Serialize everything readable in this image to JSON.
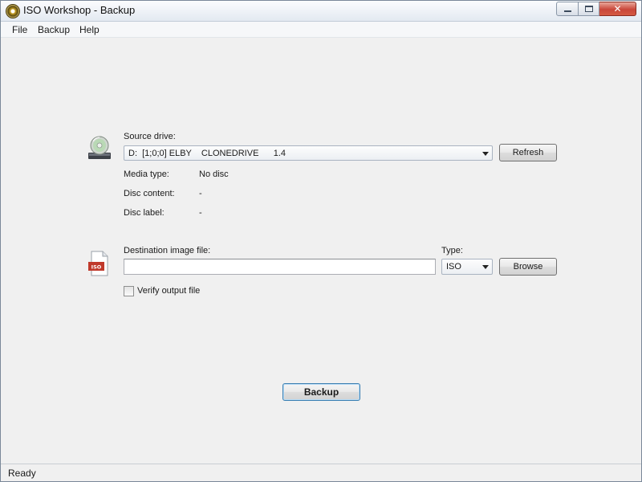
{
  "window": {
    "title": "ISO Workshop - Backup",
    "icon": "app-disc-icon"
  },
  "menu": {
    "items": [
      "File",
      "Backup",
      "Help"
    ]
  },
  "source": {
    "label": "Source drive:",
    "selected_drive": "D:  [1;0;0] ELBY    CLONEDRIVE      1.4",
    "refresh_label": "Refresh",
    "icon": "optical-drive-icon"
  },
  "info": {
    "media_type_label": "Media type:",
    "media_type_value": "No disc",
    "disc_content_label": "Disc content:",
    "disc_content_value": "-",
    "disc_label_label": "Disc label:",
    "disc_label_value": "-"
  },
  "destination": {
    "label": "Destination image file:",
    "value": "",
    "type_label": "Type:",
    "type_value": "ISO",
    "browse_label": "Browse",
    "icon": "iso-file-icon",
    "icon_text": "ISO"
  },
  "verify": {
    "label": "Verify output file",
    "checked": false
  },
  "actions": {
    "backup_label": "Backup"
  },
  "status": {
    "text": "Ready"
  },
  "colors": {
    "close_button": "#c9473a",
    "primary_button_border": "#3c7fb1",
    "iso_badge": "#c0392b"
  }
}
